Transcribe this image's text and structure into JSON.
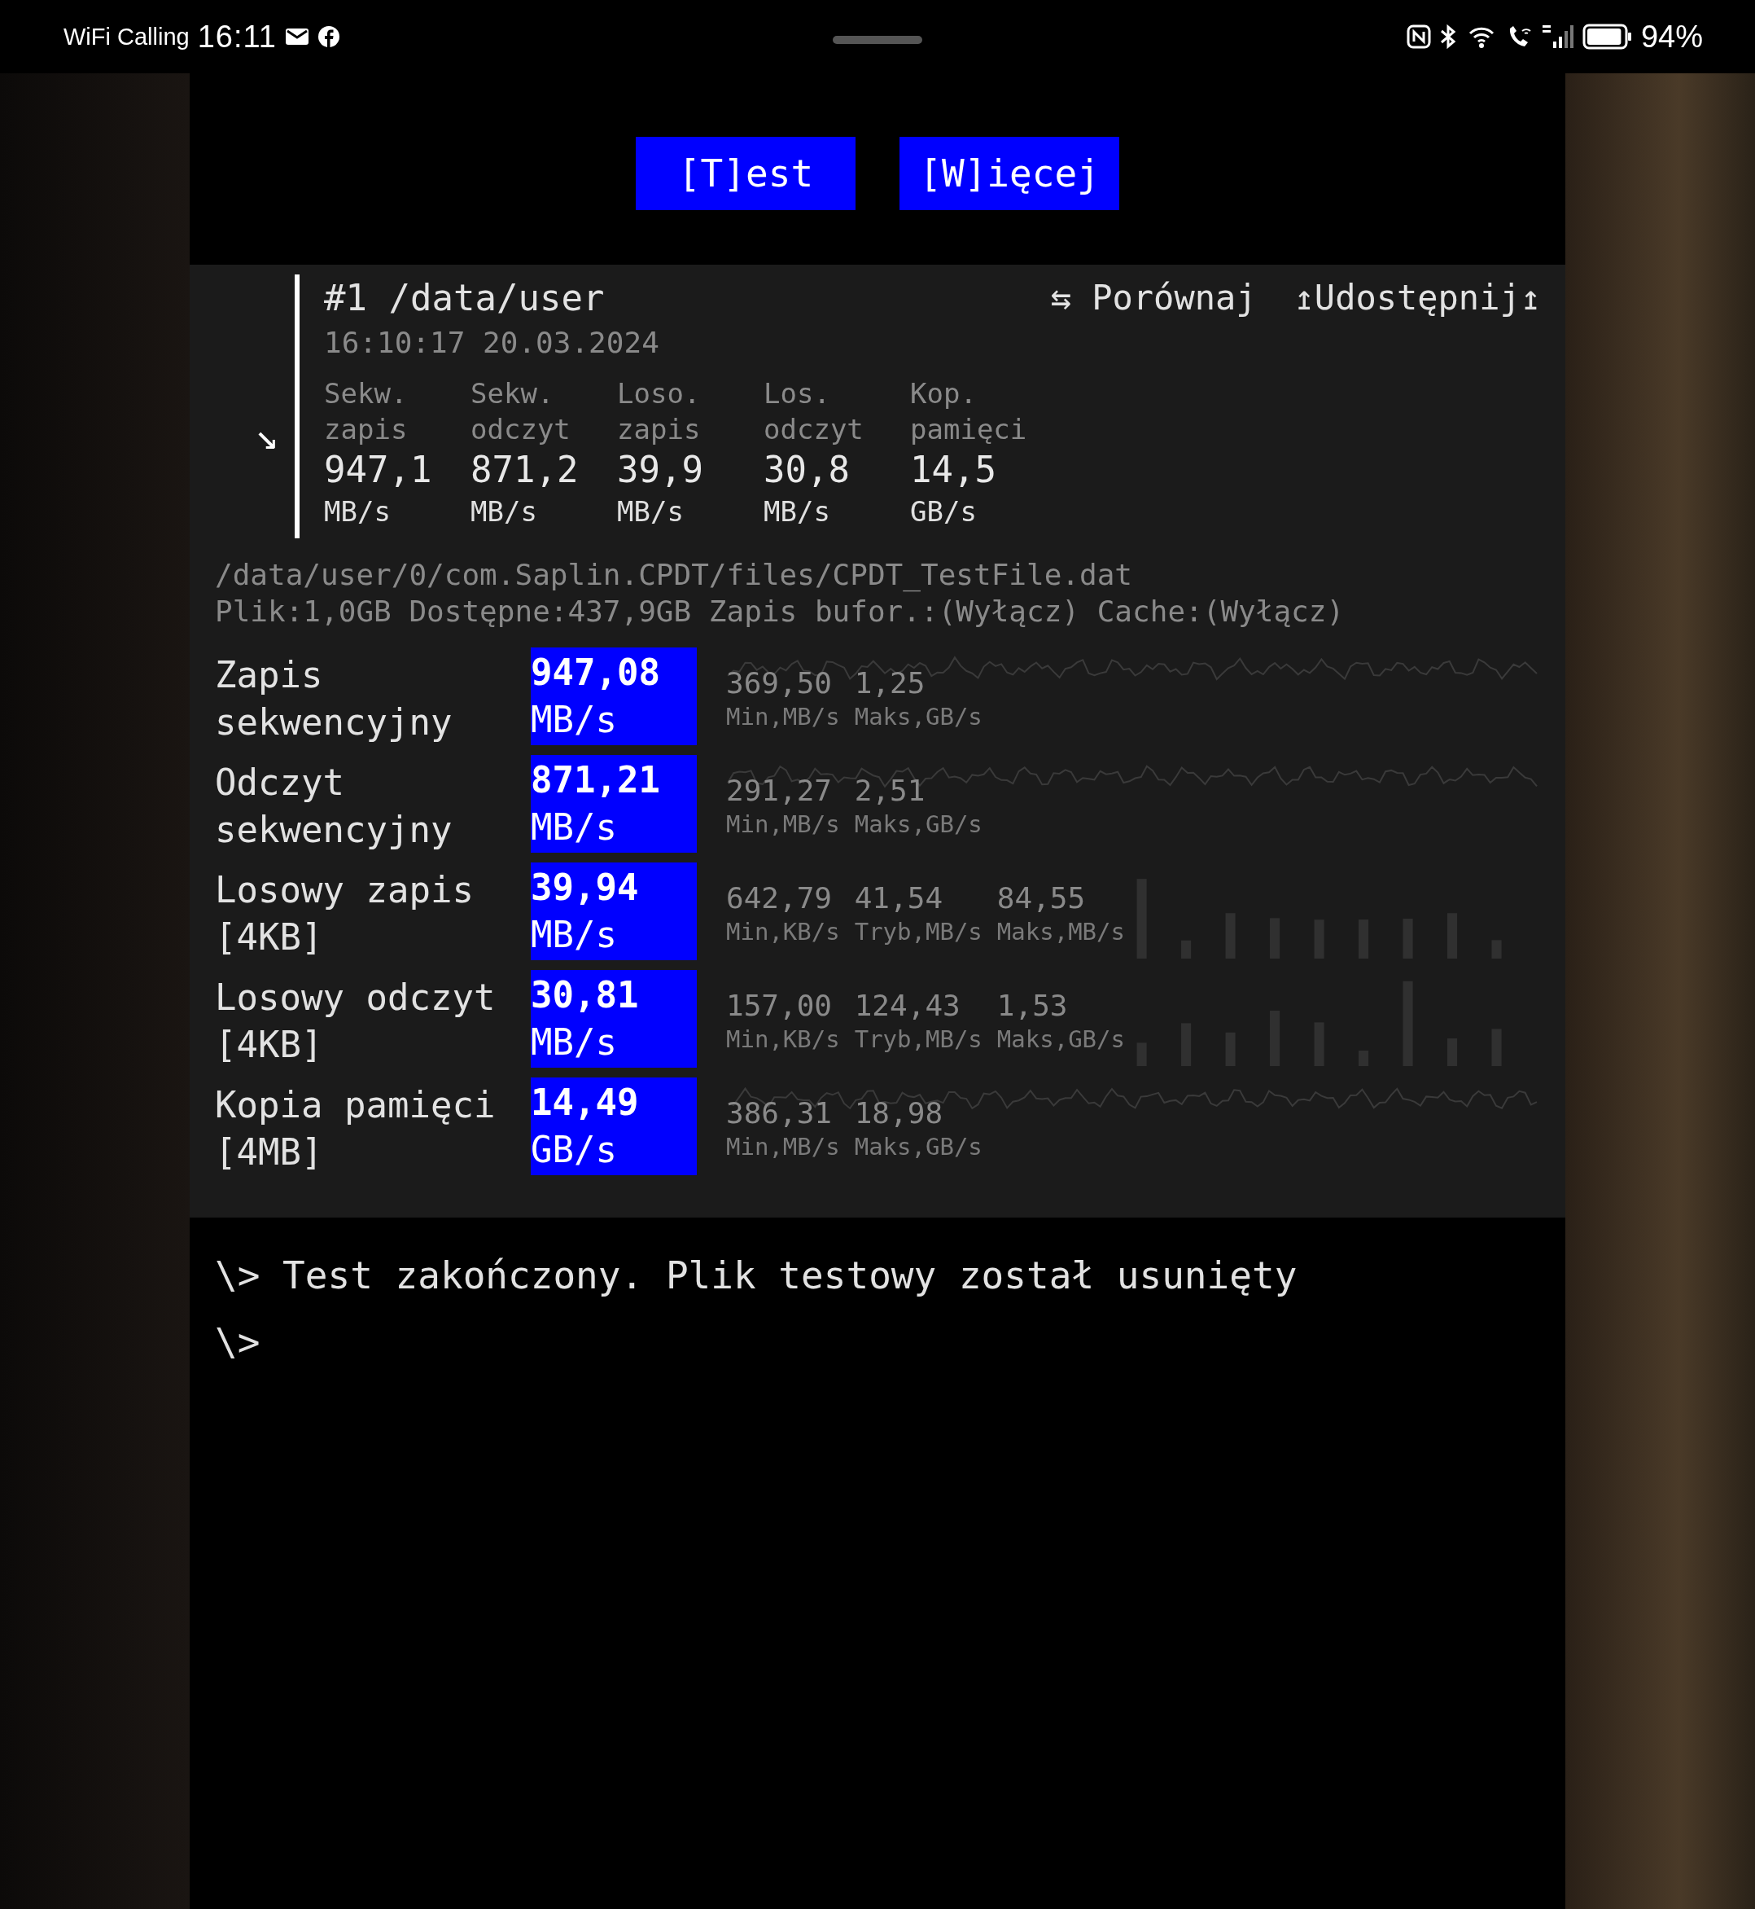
{
  "status_bar": {
    "carrier": "WiFi Calling",
    "time": "16:11",
    "battery": "94%"
  },
  "buttons": [
    {
      "label": "[T]est"
    },
    {
      "label": "[W]ięcej"
    }
  ],
  "summary": {
    "expand_arrow": "↘",
    "title": "#1 /data/user",
    "timestamp": "16:10:17 20.03.2024",
    "actions": [
      {
        "label": "⇆ Porównaj"
      },
      {
        "label": "↥Udostępnij↥"
      }
    ],
    "metrics": [
      {
        "label": "Sekw. zapis",
        "value": "947,1",
        "unit": "MB/s"
      },
      {
        "label": "Sekw. odczyt",
        "value": "871,2",
        "unit": "MB/s"
      },
      {
        "label": "Loso. zapis",
        "value": "39,9",
        "unit": "MB/s"
      },
      {
        "label": "Los. odczyt",
        "value": "30,8",
        "unit": "MB/s"
      },
      {
        "label": "Kop. pamięci",
        "value": "14,5",
        "unit": "GB/s"
      }
    ]
  },
  "file_path": "/data/user/0/com.Saplin.CPDT/files/CPDT_TestFile.dat",
  "file_info": "Plik:1,0GB Dostępne:437,9GB Zapis bufor.:(Wyłącz) Cache:(Wyłącz)",
  "results": [
    {
      "label": "Zapis sekwencyjny",
      "value": "947,08",
      "unit": "MB/s",
      "kind": "line",
      "stats": [
        {
          "value": "369,50",
          "label": "Min,MB/s"
        },
        {
          "value": "1,25",
          "label": "Maks,GB/s"
        }
      ]
    },
    {
      "label": "Odczyt sekwencyjny",
      "value": "871,21",
      "unit": "MB/s",
      "kind": "line",
      "stats": [
        {
          "value": "291,27",
          "label": "Min,MB/s"
        },
        {
          "value": "2,51",
          "label": "Maks,GB/s"
        }
      ]
    },
    {
      "label": "Losowy zapis [4KB]",
      "value": "39,94",
      "unit": "MB/s",
      "kind": "bars",
      "stats": [
        {
          "value": "642,79",
          "label": "Min,KB/s"
        },
        {
          "value": "41,54",
          "label": "Tryb,MB/s"
        },
        {
          "value": "84,55",
          "label": "Maks,MB/s"
        }
      ]
    },
    {
      "label": "Losowy odczyt [4KB]",
      "value": "30,81",
      "unit": "MB/s",
      "kind": "bars",
      "stats": [
        {
          "value": "157,00",
          "label": "Min,KB/s"
        },
        {
          "value": "124,43",
          "label": "Tryb,MB/s"
        },
        {
          "value": "1,53",
          "label": "Maks,GB/s"
        }
      ]
    },
    {
      "label": "Kopia pamięci [4MB]",
      "value": "14,49",
      "unit": "GB/s",
      "kind": "line",
      "stats": [
        {
          "value": "386,31",
          "label": "Min,MB/s"
        },
        {
          "value": "18,98",
          "label": "Maks,GB/s"
        }
      ]
    }
  ],
  "log": [
    {
      "text": "\\> Test zakończony. Plik testowy został usunięty"
    },
    {
      "text": "\\>"
    }
  ]
}
